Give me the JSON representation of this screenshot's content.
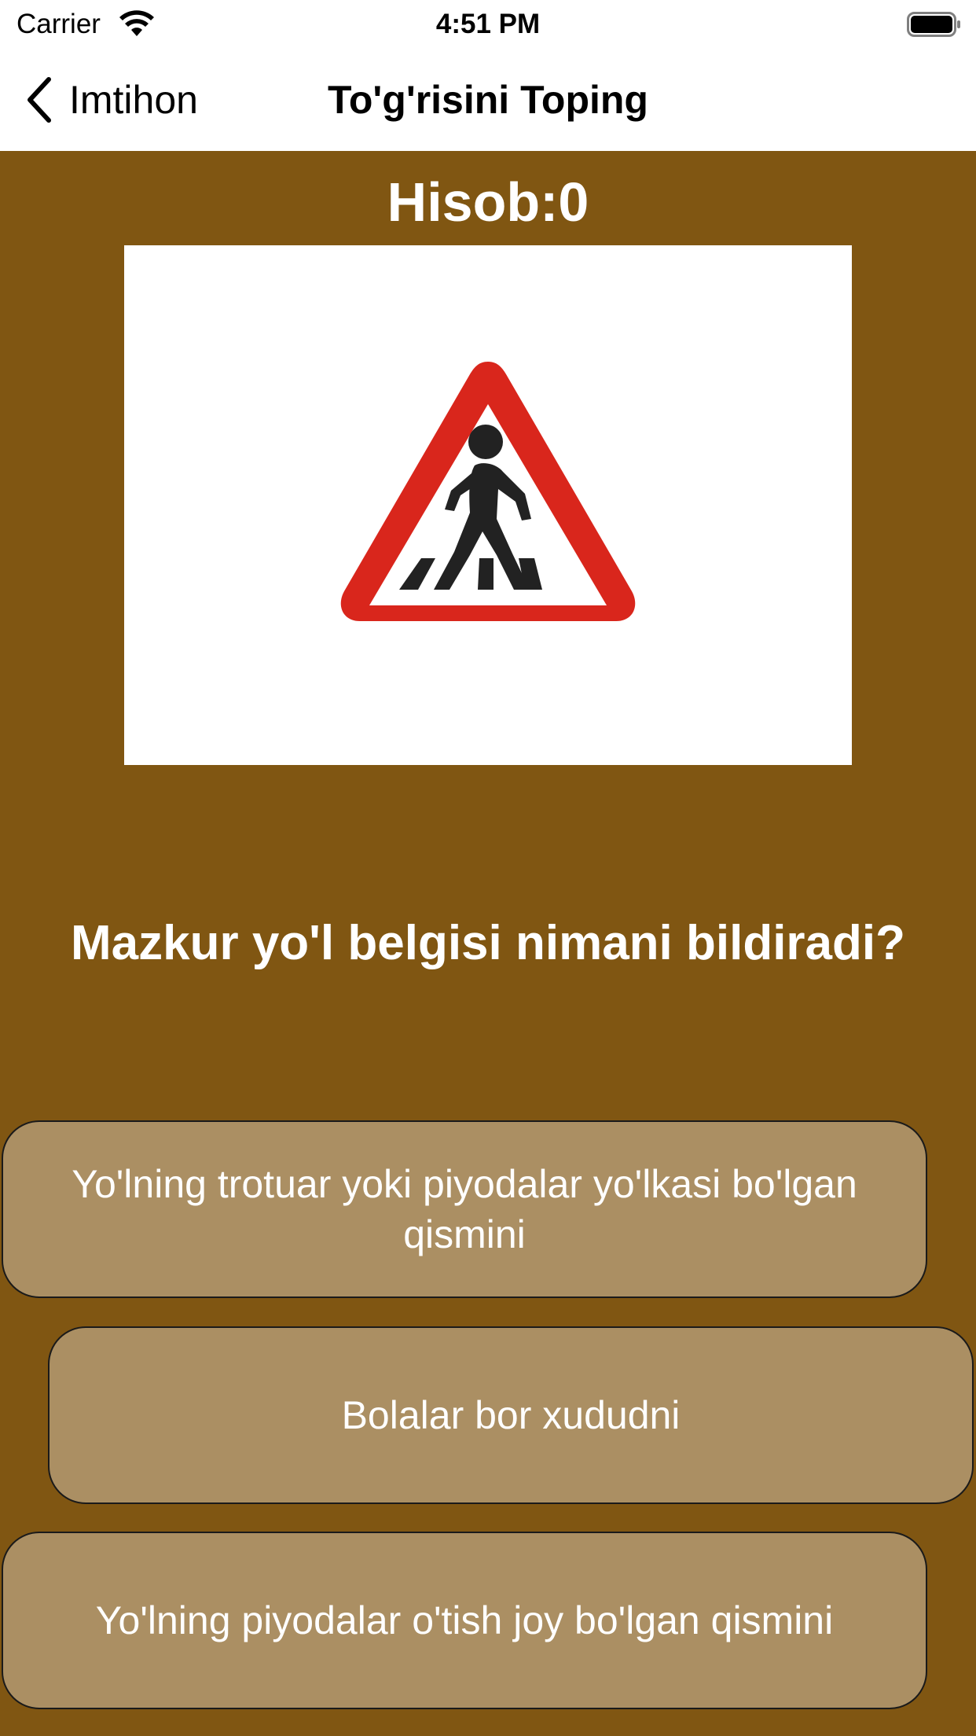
{
  "status_bar": {
    "carrier": "Carrier",
    "time": "4:51 PM"
  },
  "nav": {
    "back_label": "Imtihon",
    "title": "To'g'risini Toping"
  },
  "quiz": {
    "score_text": "Hisob:0",
    "question": "Mazkur yo'l belgisi nimani bildiradi?",
    "answers": [
      "Yo'lning trotuar yoki piyodalar yo'lkasi bo'lgan qismini",
      "Bolalar bor xududni",
      "Yo'lning piyodalar o'tish joy bo'lgan qismini"
    ]
  },
  "colors": {
    "background": "#805612",
    "answer_fill": "#ab8f63",
    "sign_red": "#d9261c"
  },
  "icons": {
    "back": "chevron-left-icon",
    "wifi": "wifi-icon",
    "battery": "battery-icon",
    "sign": "pedestrian-crossing-warning-sign"
  }
}
